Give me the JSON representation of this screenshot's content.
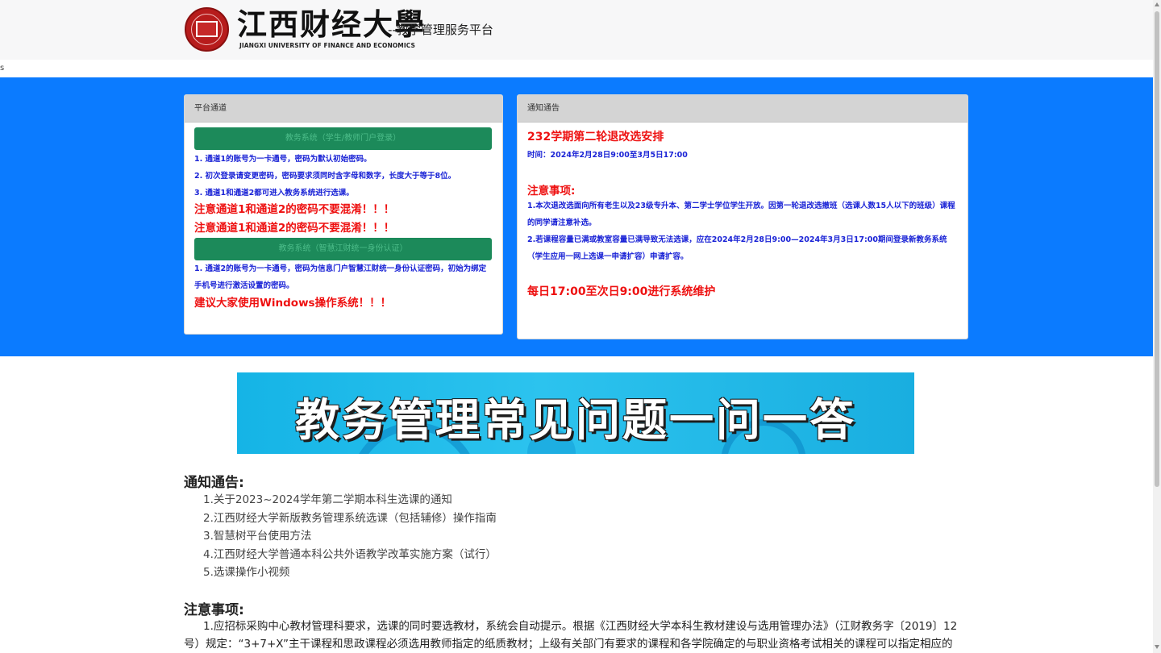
{
  "header": {
    "logo_cn": "江西财经大學",
    "logo_en": "JIANGXI UNIVERSITY OF FINANCE AND ECONOMICS",
    "subtitle": "--教学管理服务平台"
  },
  "stray_text": "s",
  "platform_panel": {
    "title": "平台通道",
    "channel1_button": "教务系统（学生/教师门户登录）",
    "channel1_notes": [
      "1. 通道1的账号为一卡通号，密码为默认初始密码。",
      "2. 初次登录请变更密码，密码要求须同时含字母和数字，长度大于等于8位。",
      "3. 通道1和通道2都可进入教务系统进行选课。"
    ],
    "warning_repeat": [
      "注意通道1和通道2的密码不要混淆！！！",
      "注意通道1和通道2的密码不要混淆！！！"
    ],
    "channel2_button": "教务系统（智慧江财统一身份认证）",
    "channel2_notes": [
      "1. 通道2的账号为一卡通号，密码为信息门户智慧江财统一身份认证密码，初始为绑定",
      "手机号进行激活设置的密码。"
    ],
    "os_tip": "建议大家使用Windows操作系统！！！"
  },
  "notice_panel": {
    "title": "通知通告",
    "headline": "232学期第二轮退改选安排",
    "time": "时间：2024年2月28日9:00至3月5日17:00",
    "attention_heading": "注意事项:",
    "items": [
      "1.本次退改选面向所有老生以及23级专升本、第二学士学位学生开放。因第一轮退改选撤班（选课人数15人以下的班级）课程的同学请注意补选。",
      "2.若课程容量已满或教室容量已满导致无法选课，应在2024年2月28日9:00—2024年3月3日17:00期间登录新教务系统（学生应用一网上选课一申请扩容）申请扩容。"
    ],
    "maintenance": "每日17:00至次日9:00进行系统维护"
  },
  "banner": {
    "text": "教务管理常见问题一问一答"
  },
  "notices_section": {
    "title": "通知通告:",
    "links": [
      "1.关于2023~2024学年第二学期本科生选课的通知",
      "2.江西财经大学新版教务管理系统选课（包括辅修）操作指南",
      "3.智慧树平台使用方法",
      "4.江西财经大学普通本科公共外语教学改革实施方案（试行）",
      "5.选课操作小视频"
    ]
  },
  "attention_section": {
    "title": "注意事项:",
    "text": "1.应招标采购中心教材管理科要求，选课的同时要选教材，系统会自动提示。根据《江西财经大学本科生教材建设与选用管理办法》（江财教务字〔2019〕12号）规定：“3+7+X”主干课程和思政课程必须选用教师指定的纸质教材；上级有关部门有要求的课程和各学院确定的与职业资格考试相关的课程可以指定相应的"
  },
  "colors": {
    "band": "#0b7bff",
    "button_green": "#1c8a5a",
    "note_blue": "#1a23d6",
    "warning_red": "#ee1111"
  }
}
